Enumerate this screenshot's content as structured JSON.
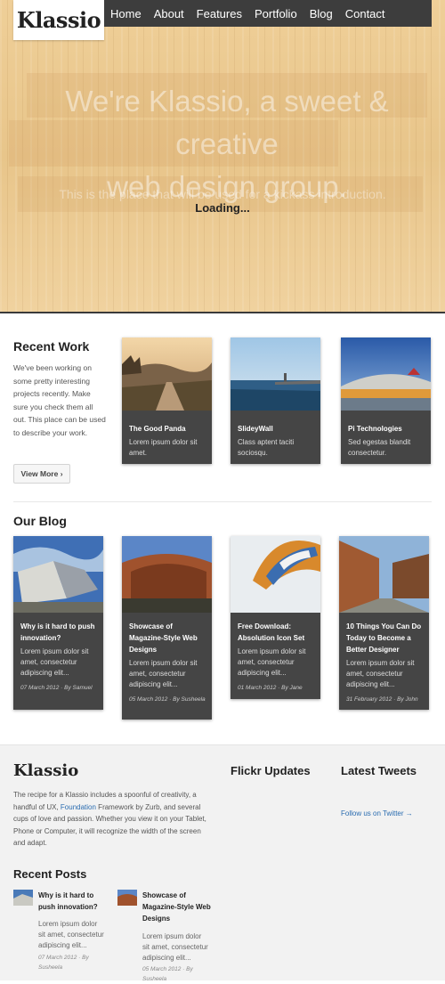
{
  "header": {
    "logo": "Klassio",
    "nav": [
      "Home",
      "About",
      "Features",
      "Portfolio",
      "Blog",
      "Contact"
    ]
  },
  "hero": {
    "heading_line1": "We're Klassio, a sweet & creative",
    "heading_line2": "web design group.",
    "subheading": "This is the place that will be used for a kickass introduction.",
    "loading": "Loading..."
  },
  "recent_work": {
    "title": "Recent Work",
    "description": "We've been working on some pretty interesting projects recently. Make sure you check them all out. This place can be used to describe your work.",
    "button": "View More ›",
    "items": [
      {
        "title": "The Good Panda",
        "text": "Lorem ipsum dolor sit amet."
      },
      {
        "title": "SlideyWall",
        "text": "Class aptent taciti sociosqu."
      },
      {
        "title": "Pi Technologies",
        "text": "Sed egestas blandit consectetur."
      }
    ]
  },
  "blog": {
    "title": "Our Blog",
    "posts": [
      {
        "title": "Why is it hard to push innovation?",
        "text": "Lorem ipsum dolor sit amet, consectetur adipiscing elit...",
        "meta": "07 March 2012 · By Samuel"
      },
      {
        "title": "Showcase of Magazine-Style Web Designs",
        "text": "Lorem ipsum dolor sit amet, consectetur adipiscing elit...",
        "meta": "05 March 2012 · By Susheela"
      },
      {
        "title": "Free Download: Absolution Icon Set",
        "text": "Lorem ipsum dolor sit amet, consectetur adipiscing elit...",
        "meta": "01 March 2012 · By Jane"
      },
      {
        "title": "10 Things You Can Do Today to Become a Better Designer",
        "text": "Lorem ipsum dolor sit amet, consectetur adipiscing elit...",
        "meta": "31 February 2012 · By John"
      }
    ]
  },
  "footer": {
    "logo": "Klassio",
    "desc_before": "The recipe for a Klassio includes a spoonful of creativity, a handful of UX, ",
    "desc_link": "Foundation",
    "desc_after": " Framework by Zurb, and several cups of love and passion. Whether you view it on your Tablet, Phone or Computer, it will recognize the width of the screen and adapt.",
    "flickr_title": "Flickr Updates",
    "tweets_title": "Latest Tweets",
    "follow_link": "Follow us on Twitter →",
    "recent_posts_title": "Recent Posts",
    "recent_posts": [
      {
        "title": "Why is it hard to push innovation?",
        "text": "Lorem ipsum dolor sit amet, consectetur adipiscing elit...",
        "meta": "07 March 2012 · By Susheela"
      },
      {
        "title": "Showcase of Magazine-Style Web Designs",
        "text": "Lorem ipsum dolor sit amet, consectetur adipiscing elit...",
        "meta": "05 March 2012 · By Susheela"
      }
    ]
  },
  "colors": {
    "nav_bg": "#3d3d3d",
    "card_bg": "#454545",
    "link": "#2a6cb0",
    "wood": "#e8c58a"
  }
}
